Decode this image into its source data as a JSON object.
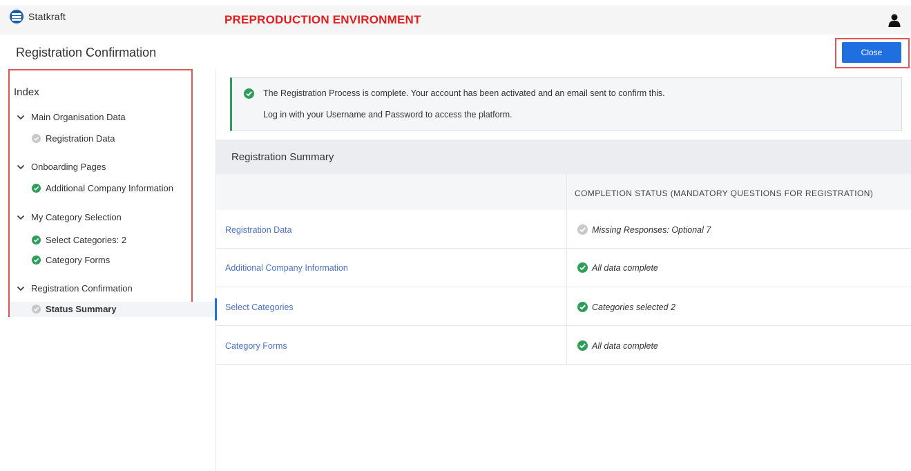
{
  "header": {
    "brand_name": "Statkraft",
    "environment_label": "PREPRODUCTION ENVIRONMENT",
    "user_icon": "user-icon"
  },
  "page": {
    "title": "Registration Confirmation",
    "close_label": "Close"
  },
  "sidebar": {
    "title": "Index",
    "groups": [
      {
        "label": "Main Organisation Data",
        "items": [
          {
            "label": "Registration Data",
            "status": "incomplete"
          }
        ]
      },
      {
        "label": "Onboarding Pages",
        "items": [
          {
            "label": "Additional Company Information",
            "status": "complete"
          }
        ]
      },
      {
        "label": "My Category Selection",
        "items": [
          {
            "label": "Select Categories: 2",
            "status": "complete"
          },
          {
            "label": "Category Forms",
            "status": "complete"
          }
        ]
      },
      {
        "label": "Registration Confirmation",
        "items": [
          {
            "label": "Status Summary",
            "status": "incomplete",
            "active": true
          }
        ]
      }
    ]
  },
  "banner": {
    "line1": "The Registration Process is complete. Your account has been activated and an email sent to confirm this.",
    "line2": "Log in with your Username and Password to access the platform."
  },
  "summary": {
    "title": "Registration Summary",
    "column_header": "COMPLETION STATUS (MANDATORY QUESTIONS FOR REGISTRATION)",
    "rows": [
      {
        "name": "Registration Data",
        "status": "Missing Responses: Optional 7",
        "state": "incomplete"
      },
      {
        "name": "Additional Company Information",
        "status": "All data complete",
        "state": "complete"
      },
      {
        "name": "Select Categories",
        "status": "Categories selected 2",
        "state": "complete"
      },
      {
        "name": "Category Forms",
        "status": "All data complete",
        "state": "complete"
      }
    ]
  },
  "colors": {
    "accent": "#1f6fe0",
    "success": "#2e9e5a",
    "warning_text": "#e11d1d",
    "link": "#4a72c6"
  }
}
